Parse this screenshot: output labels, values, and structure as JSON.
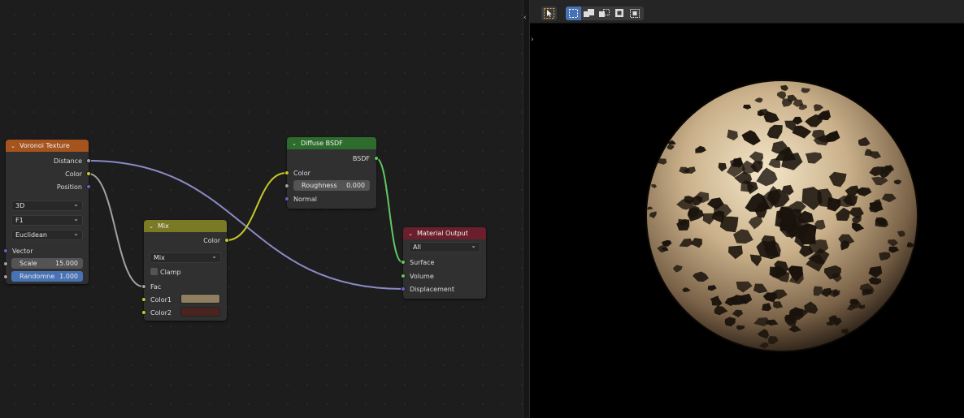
{
  "node_editor": {
    "links": [
      {
        "from": "Voronoi Texture.Distance",
        "to": "Material Output.Displacement",
        "color": "#8a8ac8"
      },
      {
        "from": "Voronoi Texture.Color",
        "to": "Mix.Fac",
        "color": "#a1a1a1"
      },
      {
        "from": "Mix.Color",
        "to": "Diffuse BSDF.Color",
        "color": "#c7c729"
      },
      {
        "from": "Diffuse BSDF.BSDF",
        "to": "Material Output.Surface",
        "color": "#63c763"
      }
    ],
    "voronoi": {
      "title": "Voronoi Texture",
      "header_color": "#a5541e",
      "out_distance": "Distance",
      "out_color": "Color",
      "out_position": "Position",
      "dimensions": "3D",
      "feature": "F1",
      "metric": "Euclidean",
      "in_vector": "Vector",
      "scale_label": "Scale",
      "scale_value": "15.000",
      "randomness_label": "Randomne",
      "randomness_value": "1.000"
    },
    "mix": {
      "title": "Mix",
      "header_color": "#7a7a24",
      "out_color": "Color",
      "blend_mode": "Mix",
      "clamp_label": "Clamp",
      "clamp_checked": false,
      "in_fac": "Fac",
      "in_color1": "Color1",
      "in_color2": "Color2",
      "color1_swatch": "#8f7f60",
      "color2_swatch": "#4a2520"
    },
    "diffuse": {
      "title": "Diffuse BSDF",
      "header_color": "#2e6c2e",
      "out_bsdf": "BSDF",
      "in_color": "Color",
      "roughness_label": "Roughness",
      "roughness_value": "0.000",
      "in_normal": "Normal"
    },
    "material_output": {
      "title": "Material Output",
      "header_color": "#6b1f2c",
      "target": "All",
      "in_surface": "Surface",
      "in_volume": "Volume",
      "in_displacement": "Displacement"
    }
  },
  "viewport": {
    "header_tools": [
      "select-cursor-icon",
      "select-box-icon",
      "select-extend-icon",
      "select-subtract-icon",
      "select-invert-icon",
      "select-intersect-icon"
    ],
    "preview": "sphere",
    "preview_colors": {
      "tan": "#c9b08a",
      "highlight": "#f4e6c8",
      "shadow": "#1a130c"
    }
  }
}
